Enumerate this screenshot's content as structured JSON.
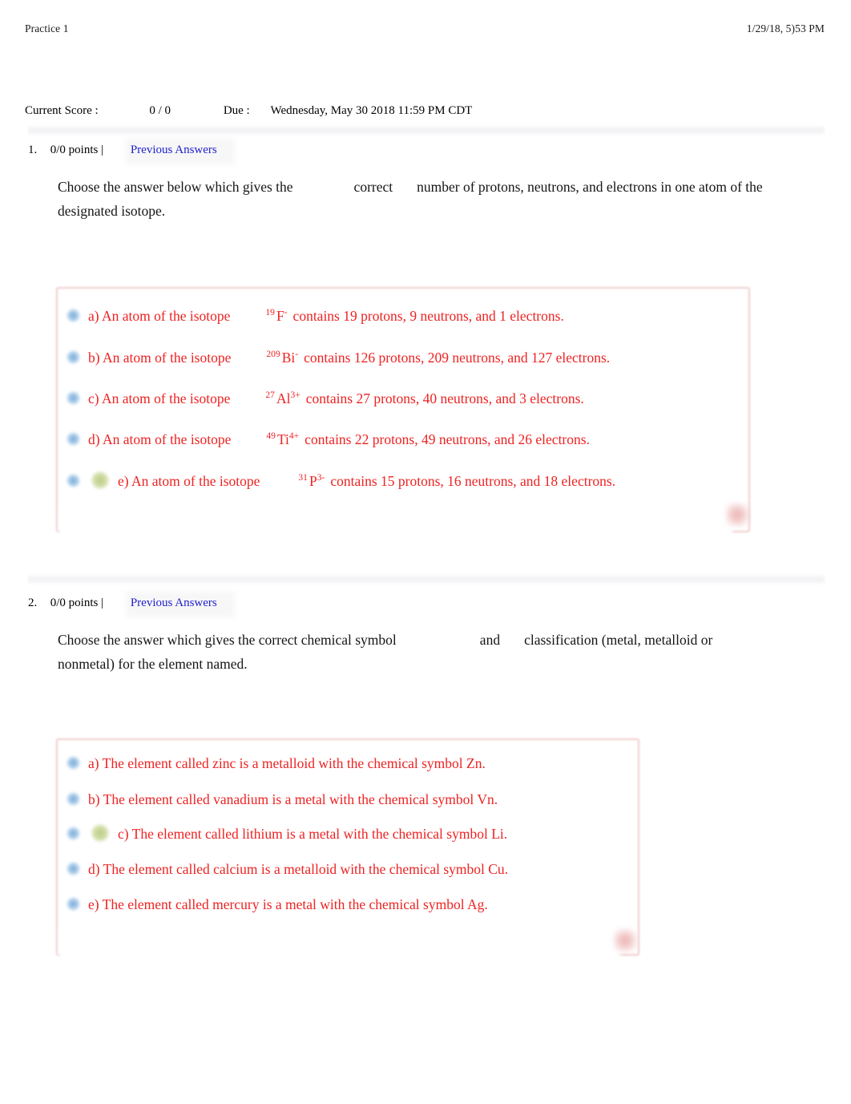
{
  "header": {
    "document_title": "Practice 1",
    "timestamp": "1/29/18, 5)53 PM"
  },
  "score_bar": {
    "current_score_label": "Current Score :",
    "current_score_value": "0 / 0",
    "due_label": "Due :",
    "due_value": "Wednesday, May 30 2018 11:59 PM CDT"
  },
  "questions": [
    {
      "number": "1.",
      "points": "0/0 points |",
      "previous_answers_link": "Previous Answers",
      "prompt_part_1": "Choose the answer below which gives the",
      "prompt_emphasis": "correct",
      "prompt_part_2": "number of protons, neutrons, and electrons in one atom of the designated isotope.",
      "result_marker": "incorrect-mark",
      "choices": [
        {
          "label": "a) An atom of the isotope",
          "mass": "19",
          "symbol": "F",
          "charge": "-",
          "detail": "contains 19 protons, 9 neutrons, and 1 electrons.",
          "selected": false,
          "marked_correct": false
        },
        {
          "label": "b) An atom of the isotope",
          "mass": "209",
          "symbol": "Bi",
          "charge": "-",
          "detail": "contains 126 protons, 209 neutrons, and 127 electrons.",
          "selected": false,
          "marked_correct": false
        },
        {
          "label": "c) An atom of the isotope",
          "mass": "27",
          "symbol": "Al",
          "charge": "3+",
          "detail": "contains 27 protons, 40 neutrons, and 3 electrons.",
          "selected": false,
          "marked_correct": false
        },
        {
          "label": "d) An atom of the isotope",
          "mass": "49",
          "symbol": "Ti",
          "charge": "4+",
          "detail": "contains 22 protons, 49 neutrons, and 26 electrons.",
          "selected": false,
          "marked_correct": false
        },
        {
          "label": "e) An atom of the isotope",
          "mass": "31",
          "symbol": "P",
          "charge": "3-",
          "detail": "contains 15 protons, 16 neutrons, and 18 electrons.",
          "selected": false,
          "marked_correct": true
        }
      ]
    },
    {
      "number": "2.",
      "points": "0/0 points |",
      "previous_answers_link": "Previous Answers",
      "prompt_part_1": "Choose the answer which gives the correct chemical symbol",
      "prompt_emphasis": "and",
      "prompt_part_2": "classification (metal, metalloid or nonmetal) for the element named.",
      "result_marker": "incorrect-mark",
      "choices": [
        {
          "text": "a) The element called zinc is a metalloid with the chemical symbol Zn.",
          "selected": false,
          "marked_correct": false
        },
        {
          "text": "b) The element called vanadium is a metal with the chemical symbol Vn.",
          "selected": false,
          "marked_correct": false
        },
        {
          "text": "c) The element called lithium is a metal with the chemical symbol Li.",
          "selected": false,
          "marked_correct": true
        },
        {
          "text": "d) The element called calcium is a metalloid with the chemical symbol Cu.",
          "selected": false,
          "marked_correct": false
        },
        {
          "text": "e) The element called mercury is a metal with the chemical symbol Ag.",
          "selected": false,
          "marked_correct": false
        }
      ]
    }
  ],
  "colors": {
    "choice_text": "#ee2222",
    "link": "#2222cc",
    "body_text": "#151515",
    "panel_border": "#ecbaba",
    "radio": "#609bd2",
    "correct_dot": "#b0c470"
  }
}
